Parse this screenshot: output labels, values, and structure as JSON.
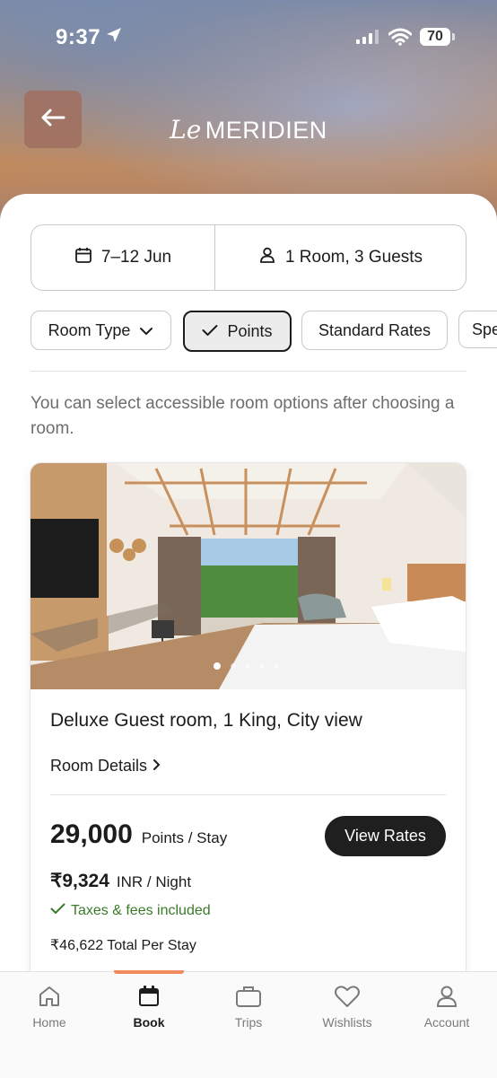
{
  "status_bar": {
    "time": "9:37",
    "battery": "70",
    "icons": [
      "location-arrow-icon",
      "signal-icon",
      "wifi-icon",
      "battery-icon"
    ]
  },
  "header": {
    "back_icon": "arrow-left-icon",
    "logo_script": "Le",
    "logo_name": "MERIDIEN"
  },
  "search": {
    "dates": "7–12 Jun",
    "dates_icon": "calendar-icon",
    "guests": "1 Room, 3 Guests",
    "guests_icon": "person-icon"
  },
  "filters": {
    "room_type": "Room Type",
    "points": "Points",
    "standard_rates": "Standard Rates",
    "special": "Spe"
  },
  "info_text": "You can select accessible room options after choosing a room.",
  "room": {
    "name": "Deluxe Guest room, 1 King, City view",
    "details_link": "Room Details",
    "points_value": "29,000",
    "points_unit": "Points / Stay",
    "view_rates": "View Rates",
    "price": "₹9,324",
    "price_unit": "INR / Night",
    "taxes": "Taxes & fees included",
    "total": "₹46,622 Total Per Stay",
    "carousel_count": 5,
    "carousel_active": 1
  },
  "tabs": {
    "home": "Home",
    "book": "Book",
    "trips": "Trips",
    "wishlists": "Wishlists",
    "account": "Account",
    "active": "Book"
  },
  "colors": {
    "accent": "#f08a5d",
    "success": "#3b7a2a",
    "button_dark": "#1f1f1f"
  }
}
